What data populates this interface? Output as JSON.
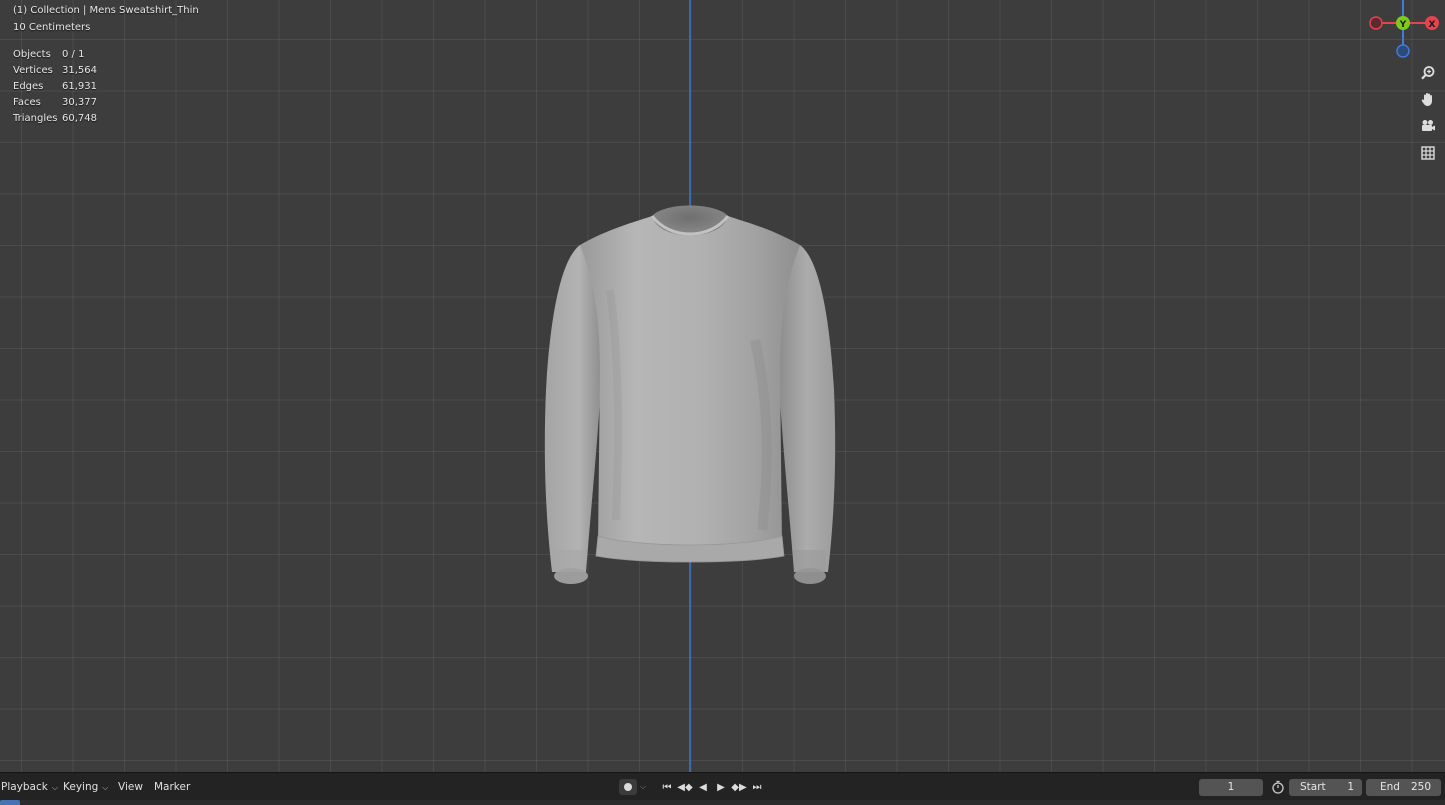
{
  "viewport": {
    "header_title": "(1) Collection | Mens Sweatshirt_Thin",
    "grid_scale": "10 Centimeters",
    "stats": [
      {
        "label": "Objects",
        "value": "0 / 1"
      },
      {
        "label": "Vertices",
        "value": "31,564"
      },
      {
        "label": "Edges",
        "value": "61,931"
      },
      {
        "label": "Faces",
        "value": "30,377"
      },
      {
        "label": "Triangles",
        "value": "60,748"
      }
    ],
    "gizmo": {
      "y_label": "Y",
      "x_label": "X",
      "colors": {
        "x": "#e8424e",
        "y": "#7ccb1c",
        "z": "#3f7bd9"
      }
    },
    "nav_tools": [
      "zoom-icon",
      "hand-pan-icon",
      "camera-icon",
      "grid-view-icon"
    ]
  },
  "timeline": {
    "menus": {
      "playback": "Playback",
      "keying": "Keying",
      "view": "View",
      "marker": "Marker"
    },
    "current_frame": "1",
    "start_label": "Start",
    "start_value": "1",
    "end_label": "End",
    "end_value": "250",
    "colors": {
      "accent": "#4772b3"
    }
  }
}
